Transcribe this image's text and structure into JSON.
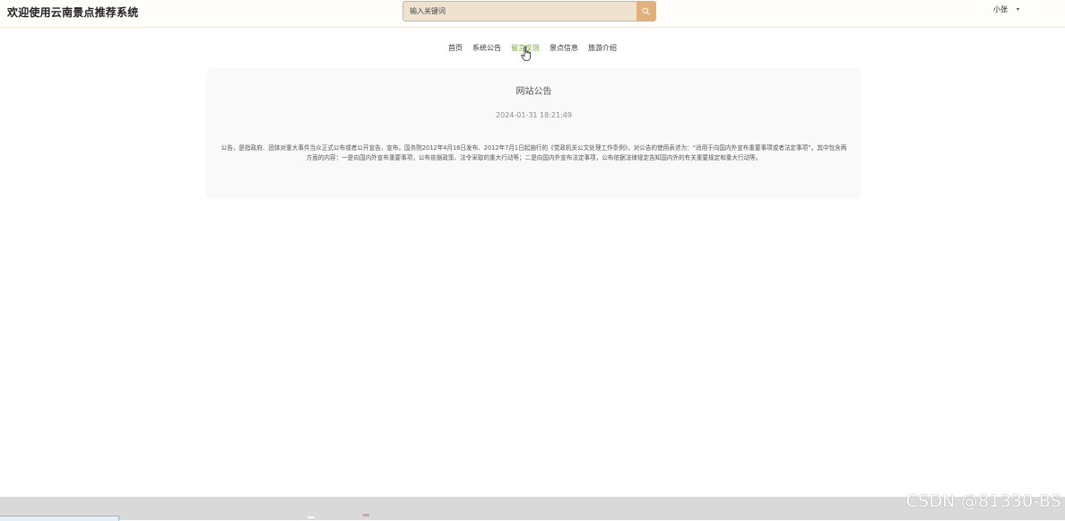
{
  "header": {
    "title": "欢迎使用云南景点推荐系统",
    "search": {
      "placeholder": "输入关键词",
      "button_icon": "search-icon"
    },
    "user": {
      "name": "小张",
      "caret": "▾"
    }
  },
  "nav": {
    "items": [
      {
        "label": "首页",
        "active": false
      },
      {
        "label": "系统公告",
        "active": false
      },
      {
        "label": "留言反馈",
        "active": true
      },
      {
        "label": "景点信息",
        "active": false
      },
      {
        "label": "旅游介绍",
        "active": false
      }
    ]
  },
  "notice": {
    "title": "网站公告",
    "time": "2024-01-31 18:21:49",
    "content": "公告，是指政府、团体对重大事件当众正式公布或者公开宣告，宣布。国务院2012年4月16日发布、2012年7月1日起施行的《党政机关公文处理工作条例》，对公告的使用表述为：“适用于向国内外宣布重要事项或者法定事项”。其中包含两方面的内容：一是向国内外宣布重要事项，公布依据政策、法令采取的重大行动等；二是向国内外宣布法定事项，公布依据法律规定告知国内外的有关重要规定和重大行动等。"
  },
  "watermark": "CSDN @81330-BS",
  "colors": {
    "accent": "#7ca935",
    "search_button": "#e0b07d",
    "search_bg": "#efe3d0",
    "card_bg": "#f9f9f9"
  }
}
